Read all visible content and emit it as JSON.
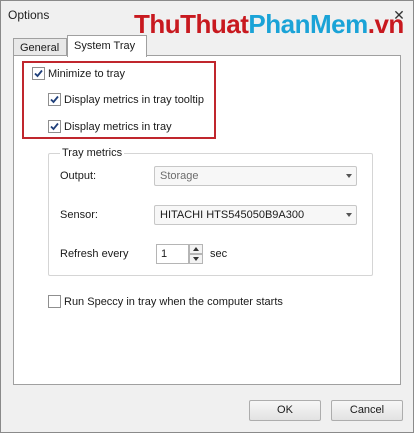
{
  "window": {
    "title": "Options",
    "watermark": {
      "part1": "ThuThuat",
      "part2": "PhanMem",
      "part3": ".vn"
    },
    "close_glyph": "✕"
  },
  "tabs": [
    {
      "label": "General",
      "active": false
    },
    {
      "label": "System Tray",
      "active": true
    }
  ],
  "tray": {
    "minimize_to_tray": {
      "label": "Minimize to tray",
      "checked": true
    },
    "display_tooltip": {
      "label": "Display metrics in tray tooltip",
      "checked": true
    },
    "display_in_tray": {
      "label": "Display metrics in tray",
      "checked": true
    }
  },
  "metrics": {
    "group_title": "Tray metrics",
    "output_label": "Output:",
    "output_value": "Storage",
    "sensor_label": "Sensor:",
    "sensor_value": "HITACHI HTS545050B9A300",
    "refresh_label": "Refresh every",
    "refresh_value": "1",
    "refresh_unit": "sec"
  },
  "startup": {
    "label": "Run Speccy in tray when the computer starts",
    "checked": false
  },
  "buttons": {
    "ok": "OK",
    "cancel": "Cancel"
  },
  "colors": {
    "highlight_border": "#c0262d",
    "checkmark": "#1f3f7a"
  }
}
